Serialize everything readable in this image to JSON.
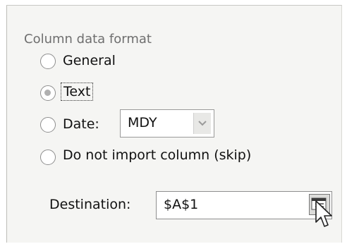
{
  "group": {
    "label": "Column data format"
  },
  "options": {
    "general": {
      "label": "General",
      "selected": false
    },
    "text": {
      "label": "Text",
      "selected": true
    },
    "date": {
      "label": "Date:",
      "selected": false
    },
    "skip": {
      "label": "Do not import column (skip)",
      "selected": false
    }
  },
  "date_format": {
    "selected": "MDY",
    "icon": "chevron-down-icon"
  },
  "destination": {
    "label": "Destination:",
    "value": "$A$1",
    "button_icon": "collapse-dialog-icon",
    "cursor_icon": "mouse-pointer-icon"
  },
  "colors": {
    "panel": "#f5f5f3",
    "label_gray": "#6f6f6f"
  }
}
